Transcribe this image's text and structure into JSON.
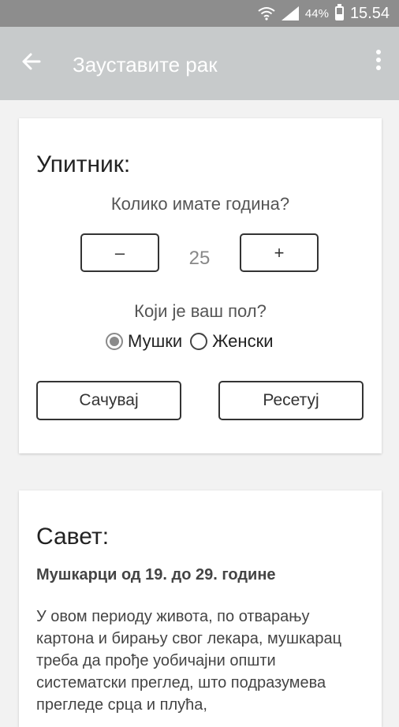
{
  "status_bar": {
    "battery_percent": "44%",
    "time": "15.54",
    "icons": [
      "wifi-icon",
      "signal-icon",
      "battery-icon"
    ]
  },
  "toolbar": {
    "title": "Зауставите рак",
    "back_icon": "arrow-left-icon",
    "menu_icon": "more-vertical-icon"
  },
  "questionnaire": {
    "heading": "Упитник:",
    "age_question": "Колико имате година?",
    "minus_label": "–",
    "age_value": "25",
    "plus_label": "+",
    "gender_question": "Који је ваш пол?",
    "gender_options": [
      {
        "label": "Мушки",
        "selected": true
      },
      {
        "label": "Женски",
        "selected": false
      }
    ],
    "save_label": "Сачувај",
    "reset_label": "Ресетуј"
  },
  "advice": {
    "heading": "Савет:",
    "subtitle": "Мушкарци од 19. до 29. године",
    "body": "У овом периоду живота, по отварању картона и бирању свог лекара, мушкарац треба да прође уобичајни општи систематски преглед, што подразумева прегледе срца и плућа,"
  },
  "colors": {
    "status_bar": "#8d8d8d",
    "toolbar": "#c7cacb",
    "background": "#f2f2f2",
    "card": "#ffffff"
  }
}
